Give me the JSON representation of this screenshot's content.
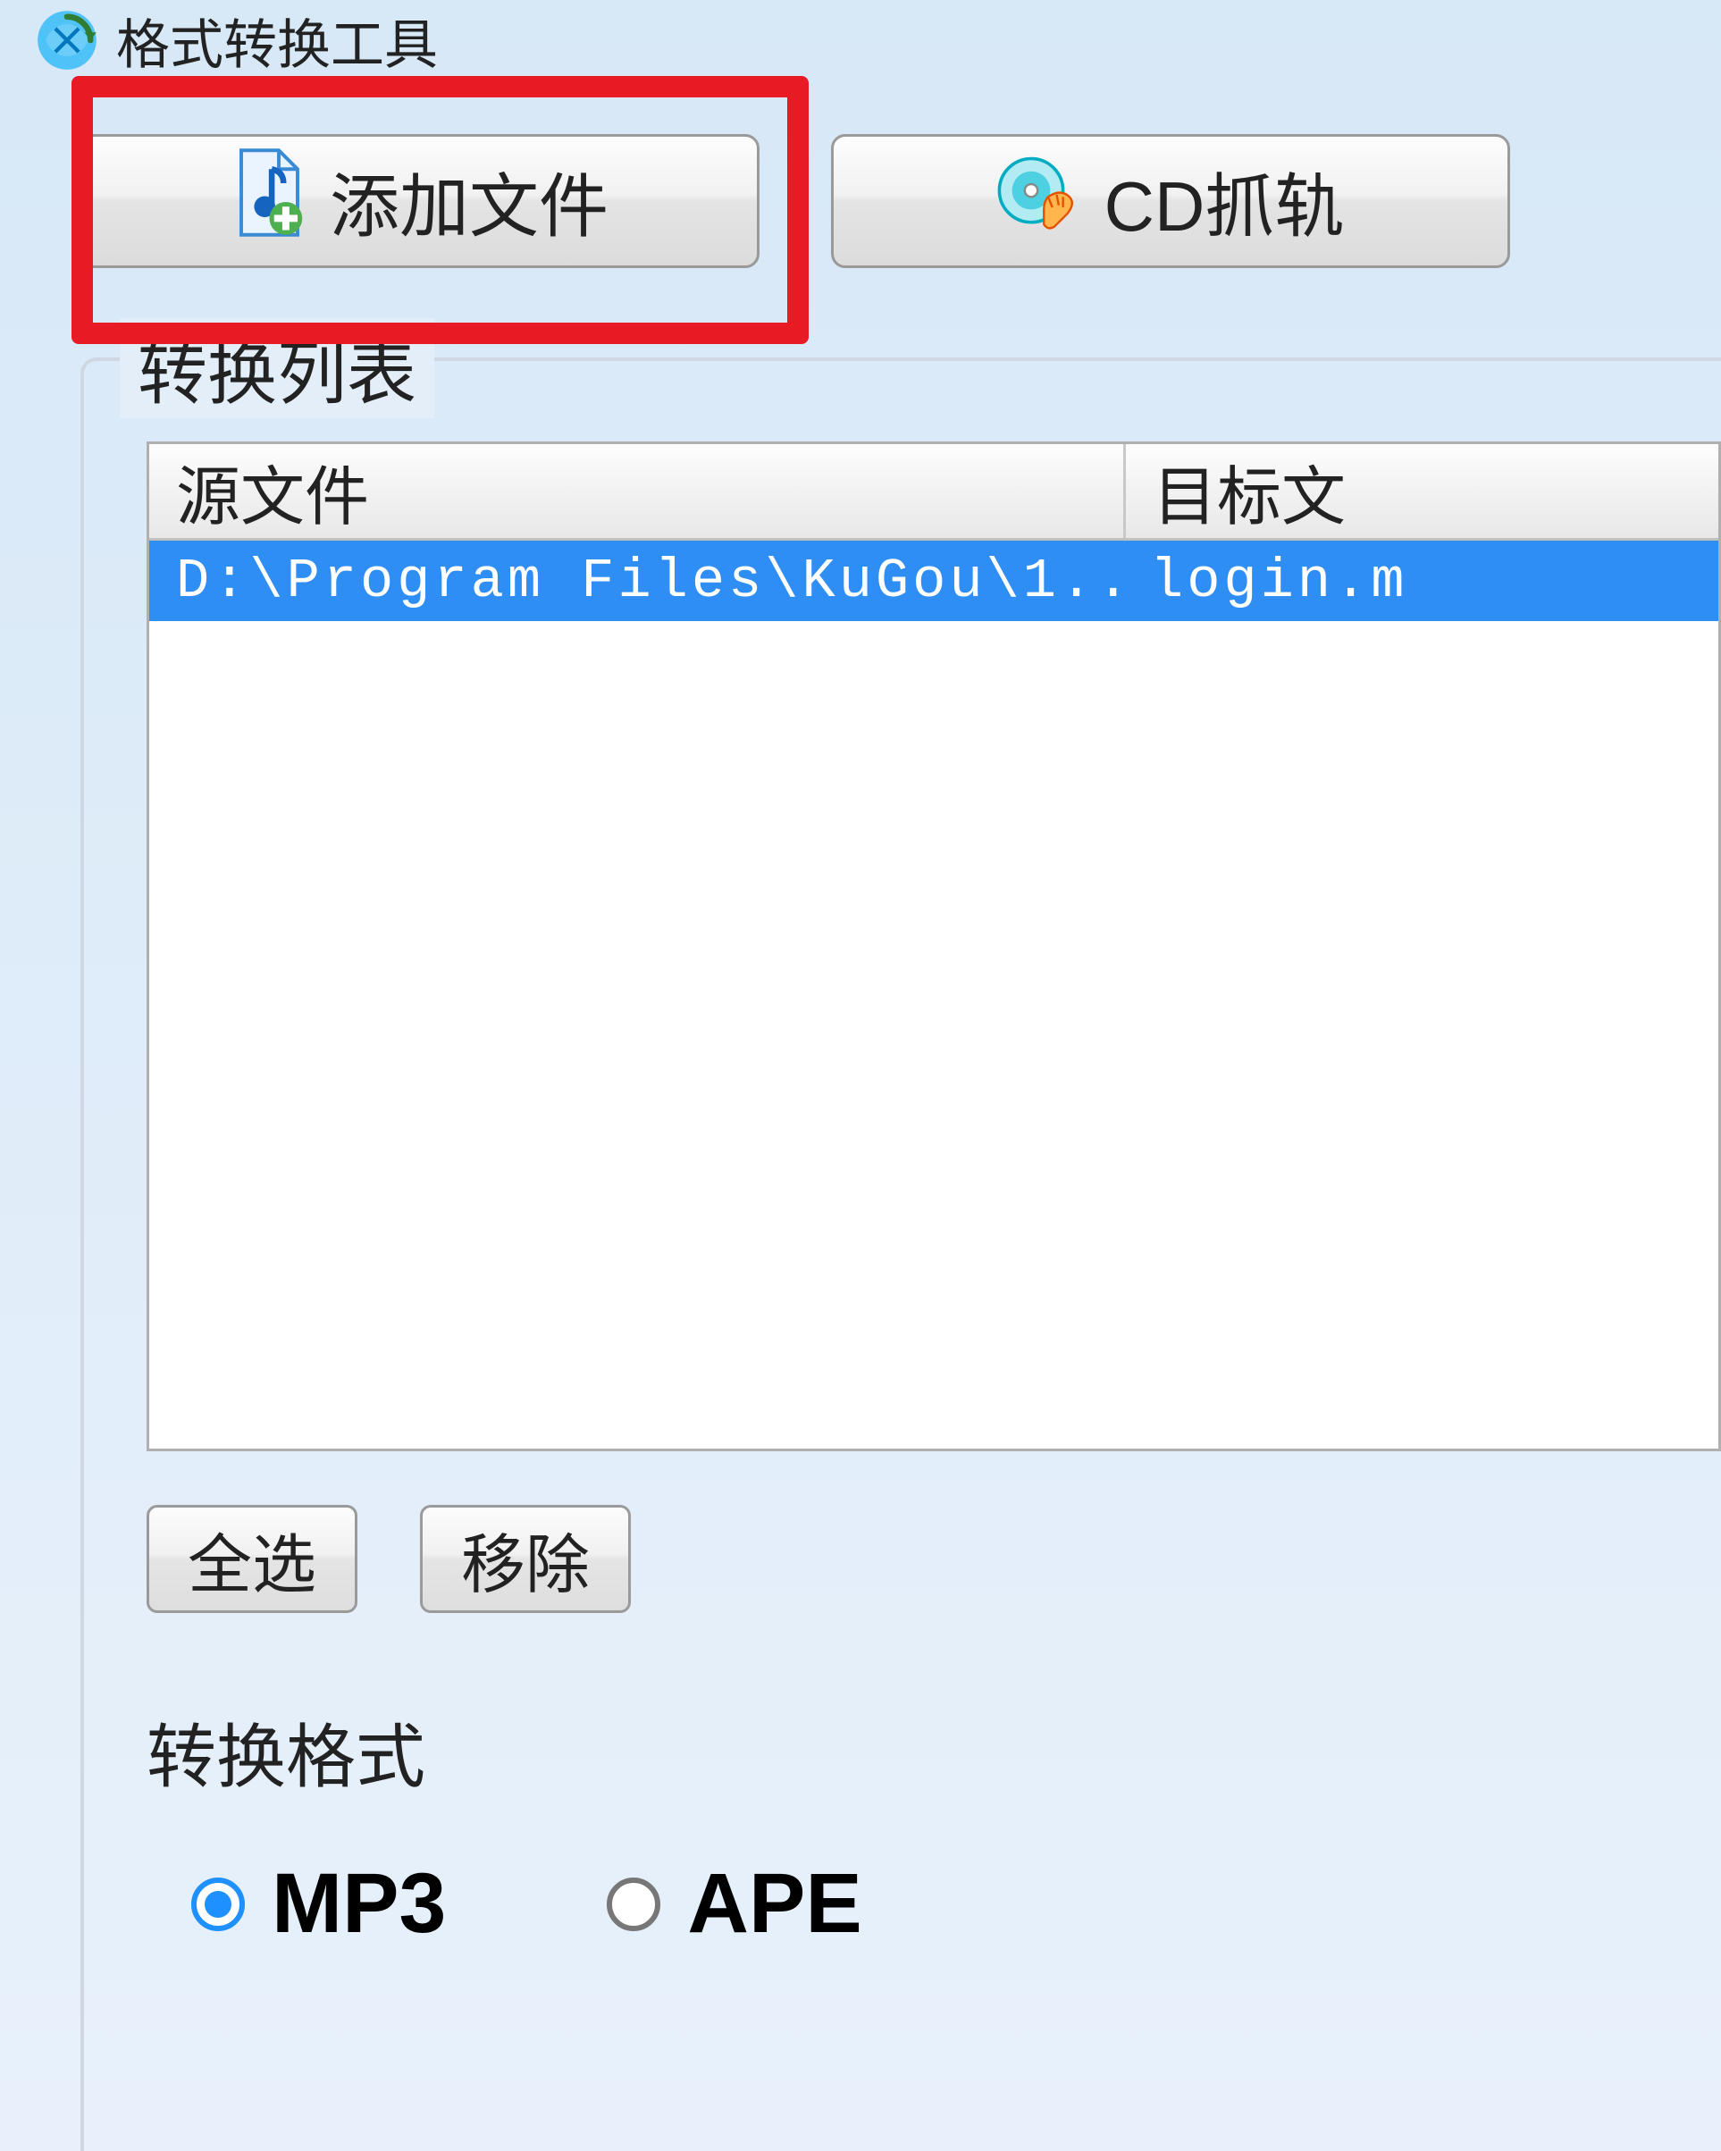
{
  "window": {
    "title": "格式转换工具"
  },
  "toolbar": {
    "add_file_label": "添加文件",
    "cd_rip_label": "CD抓轨"
  },
  "conversion_list": {
    "group_title": "转换列表",
    "columns": {
      "source": "源文件",
      "target": "目标文"
    },
    "rows": [
      {
        "source": "D:\\Program Files\\KuGou\\1..",
        "target": "login.m",
        "selected": true
      }
    ]
  },
  "list_buttons": {
    "select_all": "全选",
    "remove": "移除"
  },
  "format": {
    "title": "转换格式",
    "options": [
      {
        "label": "MP3",
        "checked": true
      },
      {
        "label": "APE",
        "checked": false
      }
    ]
  }
}
